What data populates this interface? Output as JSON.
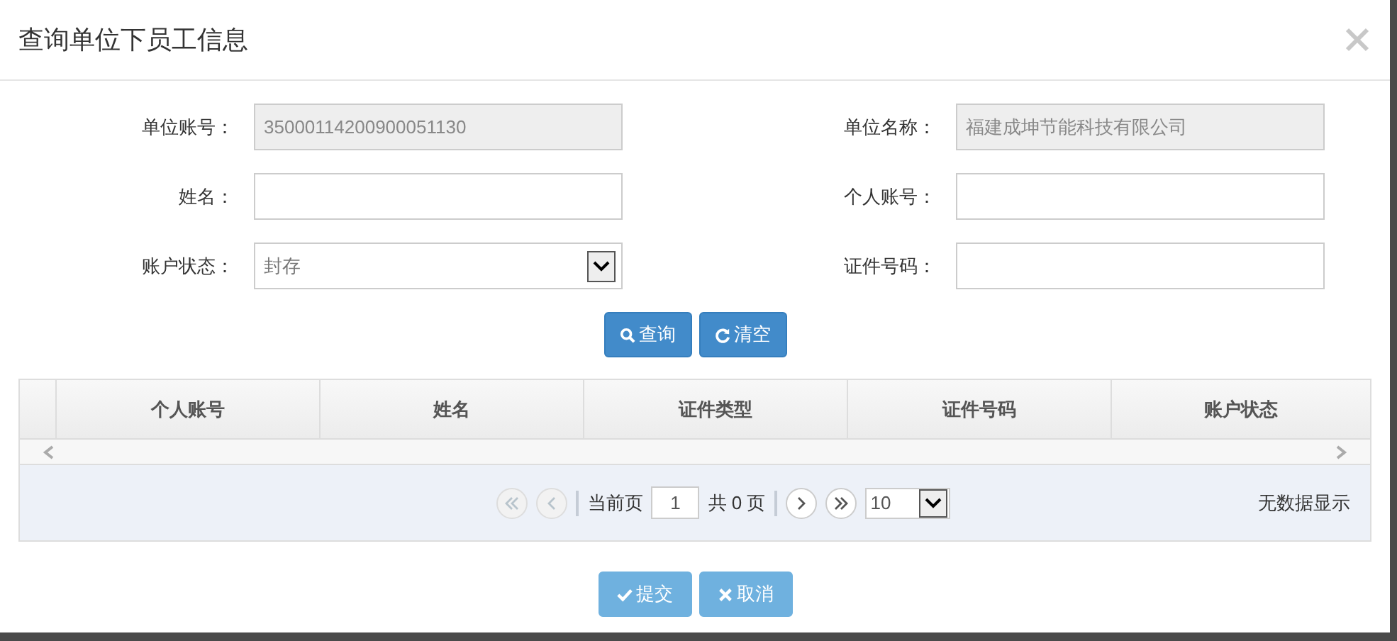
{
  "dialog": {
    "title": "查询单位下员工信息"
  },
  "form": {
    "fields": [
      {
        "label": "单位账号：",
        "kind": "text",
        "value": "35000114200900051130",
        "disabled": true
      },
      {
        "label": "单位名称：",
        "kind": "text",
        "value": "福建成坤节能科技有限公司",
        "disabled": true
      },
      {
        "label": "姓名：",
        "kind": "text",
        "disabled": false
      },
      {
        "label": "个人账号：",
        "kind": "text",
        "disabled": false
      },
      {
        "label": "账户状态：",
        "kind": "select",
        "value": "封存",
        "disabled": false
      },
      {
        "label": "证件号码：",
        "kind": "text",
        "disabled": false
      }
    ]
  },
  "search_buttons": [
    {
      "label": "查询",
      "kind": "search"
    },
    {
      "label": "清空",
      "kind": "clear"
    }
  ],
  "table": {
    "columns": [
      "个人账号",
      "姓名",
      "证件类型",
      "证件号码",
      "账户状态"
    ]
  },
  "pager": {
    "first_disabled": true,
    "prev_disabled": true,
    "next_disabled": false,
    "last_disabled": false,
    "current_label": "当前页",
    "page": "1",
    "total": "共 0 页",
    "page_size": "10",
    "empty_text": "无数据显示"
  },
  "footer_buttons": [
    {
      "label": "提交",
      "kind": "submit"
    },
    {
      "label": "取消",
      "kind": "cancel"
    }
  ]
}
